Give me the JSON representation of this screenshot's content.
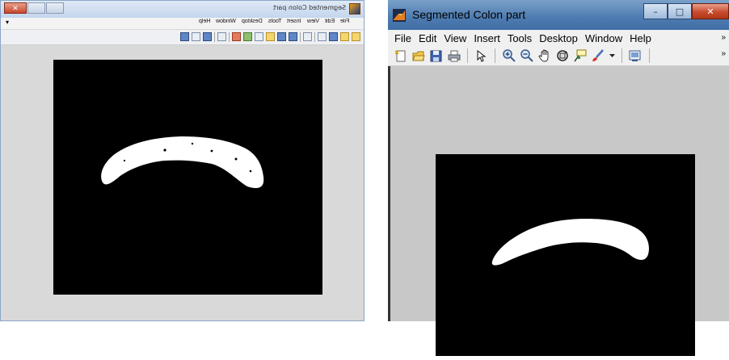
{
  "left_window": {
    "title": "Segmented Colon part",
    "menu": [
      "File",
      "Edit",
      "View",
      "Insert",
      "Tools",
      "Desktop",
      "Window",
      "Help"
    ]
  },
  "right_window": {
    "title": "Segmented Colon part",
    "caption": {
      "minimize": "–",
      "maximize": "□",
      "close": "✕"
    },
    "menu": [
      "File",
      "Edit",
      "View",
      "Insert",
      "Tools",
      "Desktop",
      "Window",
      "Help"
    ],
    "toolbar": [
      "new-figure-icon",
      "open-file-icon",
      "save-icon",
      "print-icon",
      "pointer-icon",
      "zoom-in-icon",
      "zoom-out-icon",
      "pan-hand-icon",
      "rotate-3d-icon",
      "data-cursor-icon",
      "brush-icon",
      "brush-dropdown-icon",
      "colorbar-icon"
    ]
  },
  "colors": {
    "canvas": "#000000",
    "segment": "#ffffff",
    "figure_background": "#c8c8c8"
  }
}
